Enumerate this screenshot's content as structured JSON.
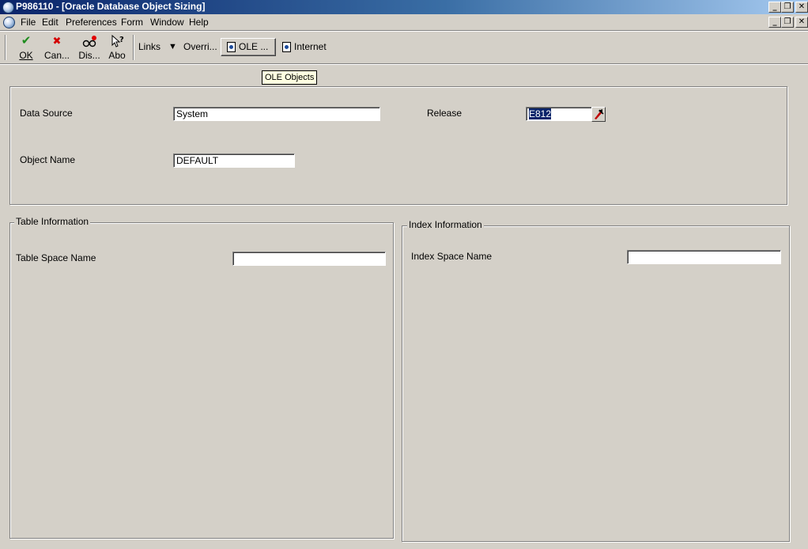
{
  "window": {
    "title": "P986110 - [Oracle Database Object Sizing]"
  },
  "menu": {
    "items": [
      "File",
      "Edit",
      "Preferences",
      "Form",
      "Window",
      "Help"
    ]
  },
  "toolbar": {
    "ok_label": "OK",
    "cancel_label": "Can...",
    "display_label": "Dis...",
    "about_label": "Abo",
    "links_label": "Links",
    "override_label": "Overri...",
    "ole_label": "OLE ...",
    "internet_label": "Internet"
  },
  "tooltip": {
    "text": "OLE Objects"
  },
  "header_form": {
    "data_source_label": "Data Source",
    "data_source_value": "System",
    "release_label": "Release",
    "release_value": "E812",
    "object_name_label": "Object Name",
    "object_name_value": "DEFAULT"
  },
  "table_info": {
    "title": "Table Information",
    "table_space_label": "Table Space Name",
    "table_space_value": ""
  },
  "index_info": {
    "title": "Index Information",
    "index_space_label": "Index Space Name",
    "index_space_value": ""
  },
  "colors": {
    "titlebar_start": "#0a246a",
    "titlebar_end": "#a6caf0",
    "ok_check": "#1e8c1e",
    "cancel_x": "#d40000",
    "selection": "#0a246a"
  }
}
